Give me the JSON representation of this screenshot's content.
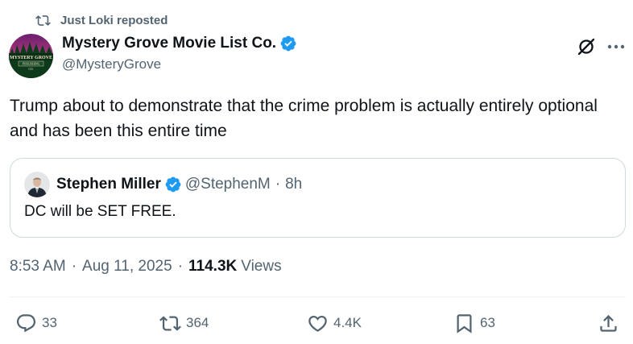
{
  "repost": {
    "text": "Just Loki reposted"
  },
  "author": {
    "name": "Mystery Grove Movie List Co.",
    "handle": "@MysteryGrove",
    "avatar_text": [
      "MYSTERY GROVE",
      "PUBLISHING",
      "CO."
    ]
  },
  "post": {
    "text": "Trump about to demonstrate that the crime problem is actually entirely optional and has been this entire time"
  },
  "quote": {
    "name": "Stephen Miller",
    "handle": "@StephenM",
    "time": "8h",
    "text": "DC will be SET FREE."
  },
  "meta": {
    "time": "8:53 AM",
    "date": "Aug 11, 2025",
    "views_count": "114.3K",
    "views_label": "Views"
  },
  "actions": {
    "reply": "33",
    "repost": "364",
    "like": "4.4K",
    "bookmark": "63"
  },
  "colors": {
    "text": "#0f1419",
    "muted": "#536471",
    "verified": "#1d9bf0",
    "border": "#cfd9de"
  },
  "icons": [
    "repost-icon",
    "verified-badge-icon",
    "grok-icon",
    "more-icon",
    "reply-icon",
    "like-icon",
    "bookmark-icon",
    "share-icon"
  ]
}
